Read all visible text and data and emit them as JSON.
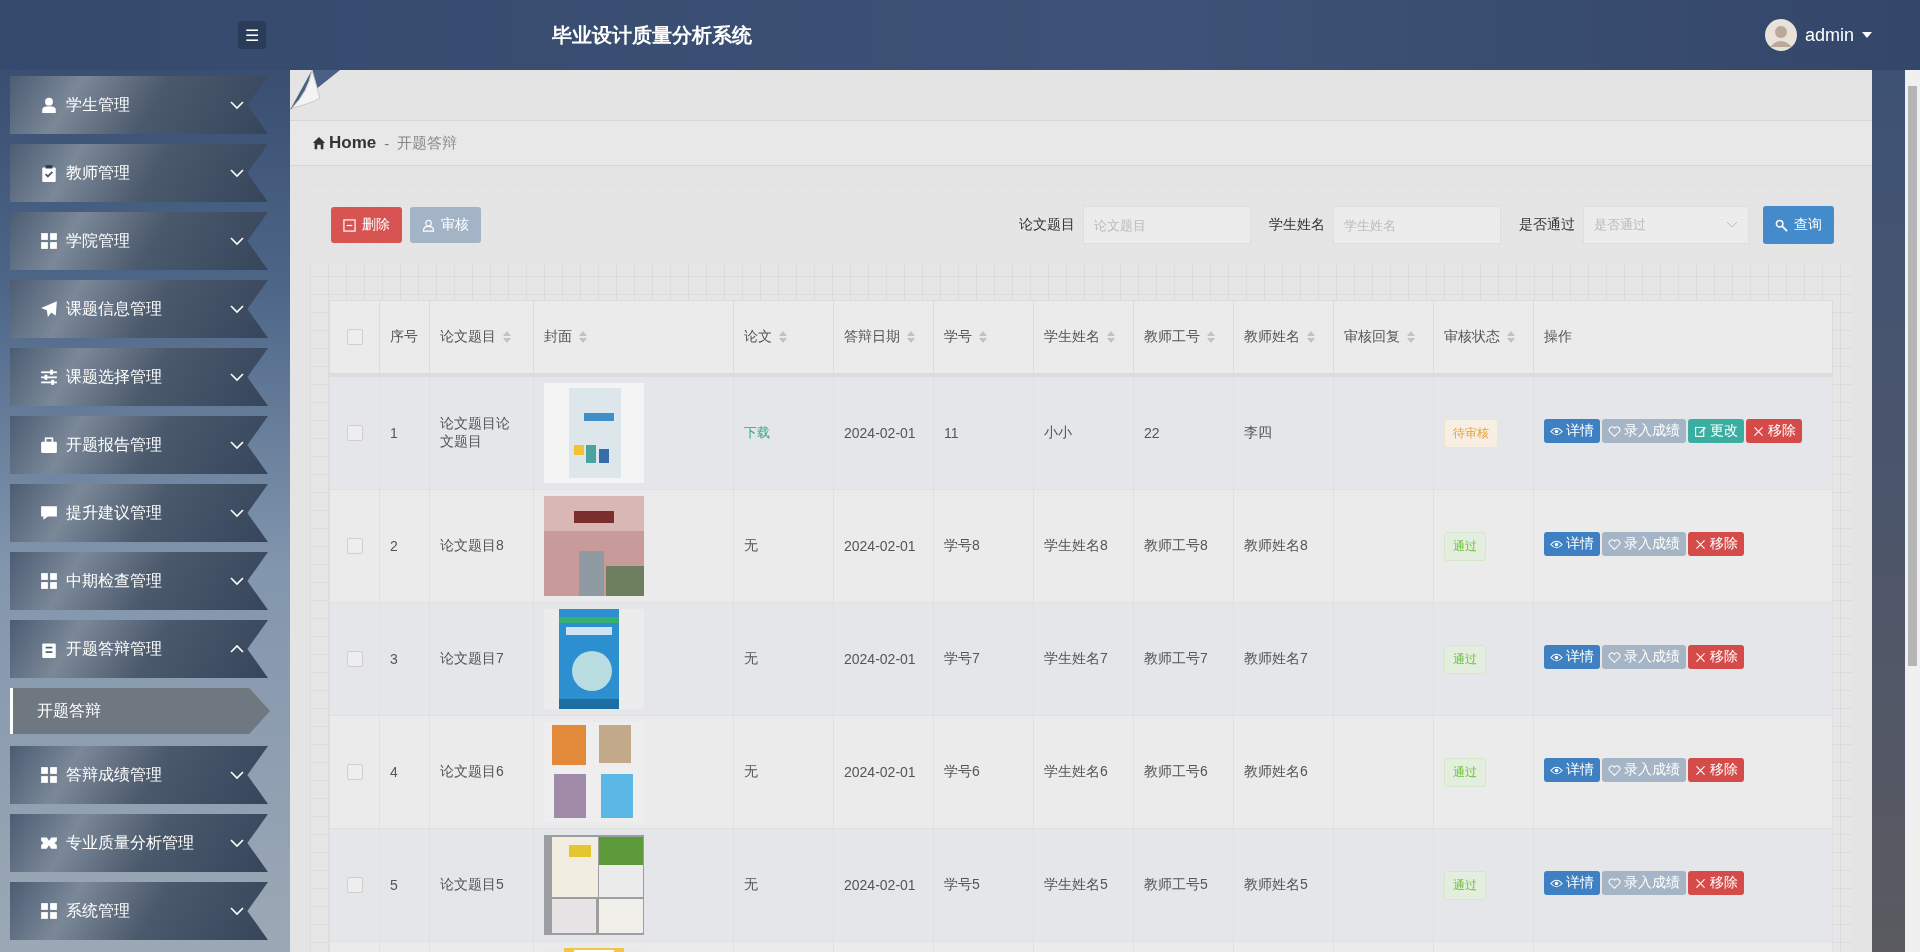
{
  "header": {
    "menu_toggle": "☰",
    "title": "毕业设计质量分析系统",
    "user": "admin"
  },
  "sidebar": {
    "items": [
      {
        "label": "学生管理",
        "expanded": false
      },
      {
        "label": "教师管理",
        "expanded": false
      },
      {
        "label": "学院管理",
        "expanded": false
      },
      {
        "label": "课题信息管理",
        "expanded": false
      },
      {
        "label": "课题选择管理",
        "expanded": false
      },
      {
        "label": "开题报告管理",
        "expanded": false
      },
      {
        "label": "提升建议管理",
        "expanded": false
      },
      {
        "label": "中期检查管理",
        "expanded": false
      },
      {
        "label": "开题答辩管理",
        "expanded": true,
        "children": [
          {
            "label": "开题答辩",
            "selected": true
          }
        ]
      },
      {
        "label": "答辩成绩管理",
        "expanded": false
      },
      {
        "label": "专业质量分析管理",
        "expanded": false
      },
      {
        "label": "系统管理",
        "expanded": false
      }
    ]
  },
  "breadcrumb": {
    "home": "Home",
    "separator": "-",
    "current": "开题答辩"
  },
  "toolbar": {
    "buttons": [
      {
        "label": "删除",
        "kind": "delete"
      },
      {
        "label": "审核",
        "kind": "audit"
      }
    ],
    "filters": [
      {
        "label": "论文题目",
        "placeholder": "论文题目",
        "kind": "input"
      },
      {
        "label": "学生姓名",
        "placeholder": "学生姓名",
        "kind": "input"
      },
      {
        "label": "是否通过",
        "placeholder": "是否通过",
        "kind": "select"
      }
    ],
    "search_button": "查询"
  },
  "table": {
    "select_all_checked": false,
    "columns": [
      {
        "label": "序号",
        "sortable": false
      },
      {
        "label": "论文题目",
        "sortable": true
      },
      {
        "label": "封面",
        "sortable": true
      },
      {
        "label": "论文",
        "sortable": true
      },
      {
        "label": "答辩日期",
        "sortable": true
      },
      {
        "label": "学号",
        "sortable": true
      },
      {
        "label": "学生姓名",
        "sortable": true
      },
      {
        "label": "教师工号",
        "sortable": true
      },
      {
        "label": "教师姓名",
        "sortable": true
      },
      {
        "label": "审核回复",
        "sortable": true
      },
      {
        "label": "审核状态",
        "sortable": true
      },
      {
        "label": "操作",
        "sortable": false
      }
    ],
    "rows": [
      {
        "checked": false,
        "index": "1",
        "title": "论文题目论文题目",
        "cover": {
          "kind": "picture"
        },
        "paper": {
          "text": "下载",
          "kind": "link"
        },
        "date": "2024-02-01",
        "student_no": "11",
        "student_name": "小小",
        "teacher_no": "22",
        "teacher_name": "李四",
        "status": {
          "text": "待审核",
          "kind": "pending"
        },
        "actions": [
          {
            "label": "详情",
            "kind": "detail"
          },
          {
            "label": "录入成绩",
            "kind": "grade"
          },
          {
            "label": "更改",
            "kind": "edit"
          },
          {
            "label": "移除",
            "kind": "remove"
          }
        ]
      },
      {
        "checked": false,
        "index": "2",
        "title": "论文题目8",
        "cover": {
          "kind": "picture"
        },
        "paper": {
          "text": "无",
          "kind": "text"
        },
        "date": "2024-02-01",
        "student_no": "学号8",
        "student_name": "学生姓名8",
        "teacher_no": "教师工号8",
        "teacher_name": "教师姓名8",
        "status": {
          "text": "通过",
          "kind": "passed"
        },
        "actions": [
          {
            "label": "详情",
            "kind": "detail"
          },
          {
            "label": "录入成绩",
            "kind": "grade"
          },
          {
            "label": "移除",
            "kind": "remove"
          }
        ]
      },
      {
        "checked": false,
        "index": "3",
        "title": "论文题目7",
        "cover": {
          "kind": "picture"
        },
        "paper": {
          "text": "无",
          "kind": "text"
        },
        "date": "2024-02-01",
        "student_no": "学号7",
        "student_name": "学生姓名7",
        "teacher_no": "教师工号7",
        "teacher_name": "教师姓名7",
        "status": {
          "text": "通过",
          "kind": "passed"
        },
        "actions": [
          {
            "label": "详情",
            "kind": "detail"
          },
          {
            "label": "录入成绩",
            "kind": "grade"
          },
          {
            "label": "移除",
            "kind": "remove"
          }
        ]
      },
      {
        "checked": false,
        "index": "4",
        "title": "论文题目6",
        "cover": {
          "kind": "picture"
        },
        "paper": {
          "text": "无",
          "kind": "text"
        },
        "date": "2024-02-01",
        "student_no": "学号6",
        "student_name": "学生姓名6",
        "teacher_no": "教师工号6",
        "teacher_name": "教师姓名6",
        "status": {
          "text": "通过",
          "kind": "passed"
        },
        "actions": [
          {
            "label": "详情",
            "kind": "detail"
          },
          {
            "label": "录入成绩",
            "kind": "grade"
          },
          {
            "label": "移除",
            "kind": "remove"
          }
        ]
      },
      {
        "checked": false,
        "index": "5",
        "title": "论文题目5",
        "cover": {
          "kind": "picture"
        },
        "paper": {
          "text": "无",
          "kind": "text"
        },
        "date": "2024-02-01",
        "student_no": "学号5",
        "student_name": "学生姓名5",
        "teacher_no": "教师工号5",
        "teacher_name": "教师姓名5",
        "status": {
          "text": "通过",
          "kind": "passed"
        },
        "actions": [
          {
            "label": "详情",
            "kind": "detail"
          },
          {
            "label": "录入成绩",
            "kind": "grade"
          },
          {
            "label": "移除",
            "kind": "remove"
          }
        ]
      },
      {
        "cover": {
          "kind": "picture"
        }
      }
    ]
  }
}
